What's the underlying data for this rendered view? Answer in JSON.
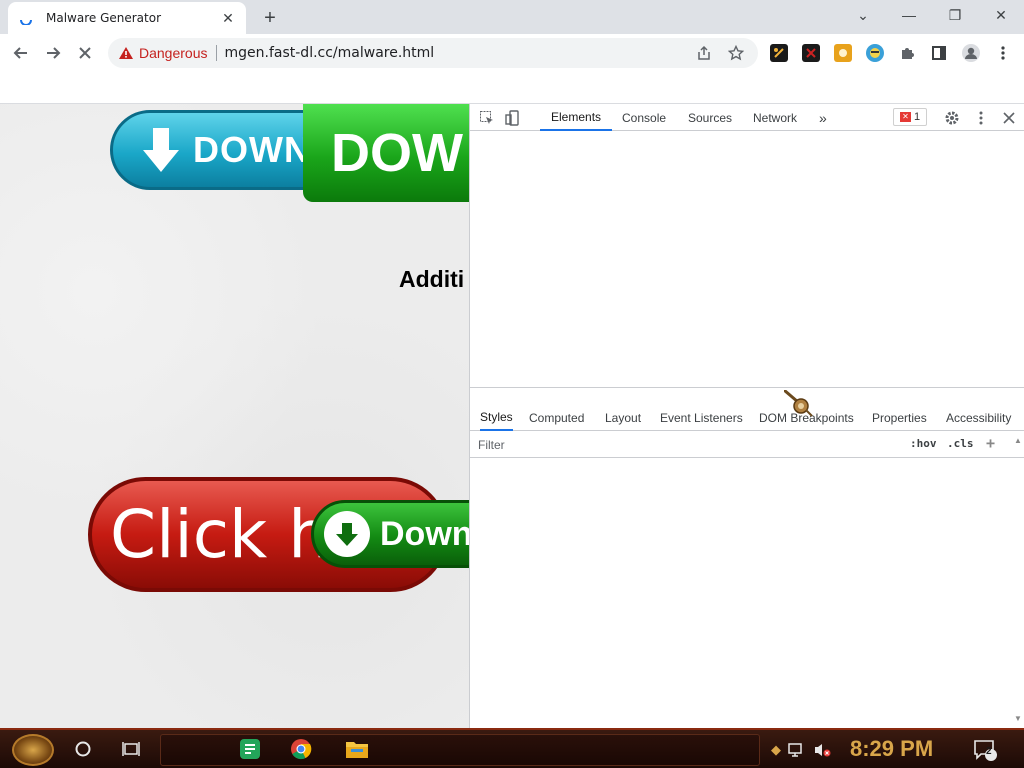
{
  "browser": {
    "tab": {
      "title": "Malware Generator",
      "close_glyph": "✕"
    },
    "new_tab_glyph": "+",
    "window_controls": {
      "chevron": "⌄",
      "minimize": "—",
      "restore": "❐",
      "close": "✕"
    },
    "nav": {
      "back": "←",
      "forward": "→",
      "stop": "✕"
    },
    "omnibox": {
      "security_label": "Dangerous",
      "url": "mgen.fast-dl.cc/malware.html"
    },
    "extensions": [
      {
        "name": "extension-1-icon",
        "color": "#1a1a1a",
        "glyph": "✎"
      },
      {
        "name": "extension-2-icon",
        "color": "#1a1a1a",
        "glyph": "✱"
      },
      {
        "name": "extension-3-icon",
        "color": "#e8a21c",
        "glyph": "✋"
      },
      {
        "name": "extension-4-icon",
        "color": "#3aa0d8",
        "glyph": "☺"
      }
    ]
  },
  "page": {
    "download_teal_label": "DOWNL",
    "download_green_label": "DOW",
    "additional_text": "Additi",
    "click_here_label": "Click h",
    "download_small_label": "Down"
  },
  "devtools": {
    "top_tabs": [
      "Elements",
      "Console",
      "Sources",
      "Network"
    ],
    "more_tabs_glyph": "»",
    "error_count": "1",
    "sub_tabs": [
      "Styles",
      "Computed",
      "Layout",
      "Event Listeners",
      "DOM Breakpoints",
      "Properties",
      "Accessibility"
    ],
    "filter_placeholder": "Filter",
    "hov_label": ":hov",
    "cls_label": ".cls",
    "add_glyph": "+"
  },
  "taskbar": {
    "clock": "8:29 PM",
    "notification_count": "2"
  },
  "colors": {
    "danger": "#c5221f",
    "active_tab_underline": "#1a73e8",
    "clock": "#d9a64a"
  }
}
